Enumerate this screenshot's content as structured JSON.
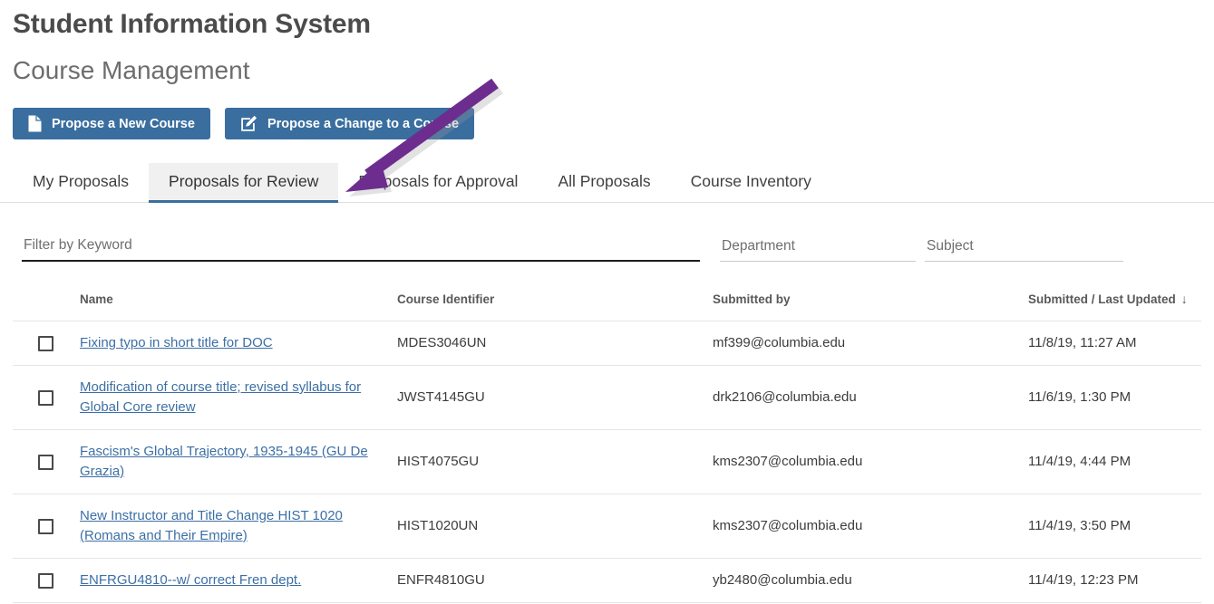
{
  "header": {
    "app_title": "Student Information System",
    "page_subtitle": "Course Management"
  },
  "toolbar": {
    "propose_new_label": "Propose a New Course",
    "propose_new_icon": "document-icon",
    "propose_change_label": "Propose a Change to a Course",
    "propose_change_icon": "edit-pencil-icon",
    "button_color": "#3a6e9f"
  },
  "tabs": [
    {
      "label": "My Proposals",
      "active": false
    },
    {
      "label": "Proposals for Review",
      "active": true
    },
    {
      "label": "Proposals for Approval",
      "active": false
    },
    {
      "label": "All Proposals",
      "active": false
    },
    {
      "label": "Course Inventory",
      "active": false
    }
  ],
  "filters": {
    "keyword": {
      "placeholder": "Filter by Keyword",
      "value": ""
    },
    "department": {
      "placeholder": "Department",
      "value": ""
    },
    "subject": {
      "placeholder": "Subject",
      "value": ""
    }
  },
  "table": {
    "columns": [
      "Name",
      "Course Identifier",
      "Submitted by",
      "Submitted / Last Updated"
    ],
    "sort_column": "Submitted / Last Updated",
    "sort_direction_icon": "↓",
    "rows": [
      {
        "checked": false,
        "name": "Fixing typo in short title for DOC",
        "identifier": "MDES3046UN",
        "submitted_by": "mf399@columbia.edu",
        "submitted_at": "11/8/19, 11:27 AM"
      },
      {
        "checked": false,
        "name": "Modification of course title; revised syllabus for Global Core review",
        "identifier": "JWST4145GU",
        "submitted_by": "drk2106@columbia.edu",
        "submitted_at": "11/6/19, 1:30 PM"
      },
      {
        "checked": false,
        "name": "Fascism's Global Trajectory, 1935-1945 (GU De Grazia)",
        "identifier": "HIST4075GU",
        "submitted_by": "kms2307@columbia.edu",
        "submitted_at": "11/4/19, 4:44 PM"
      },
      {
        "checked": false,
        "name": "New Instructor and Title Change HIST 1020 (Romans and Their Empire)",
        "identifier": "HIST1020UN",
        "submitted_by": "kms2307@columbia.edu",
        "submitted_at": "11/4/19, 3:50 PM"
      },
      {
        "checked": false,
        "name": "ENFRGU4810--w/ correct Fren dept.",
        "identifier": "ENFR4810GU",
        "submitted_by": "yb2480@columbia.edu",
        "submitted_at": "11/4/19, 12:23 PM"
      }
    ]
  },
  "annotation": {
    "type": "arrow",
    "color": "#6d2d8f",
    "points_to": "Proposals for Review"
  }
}
